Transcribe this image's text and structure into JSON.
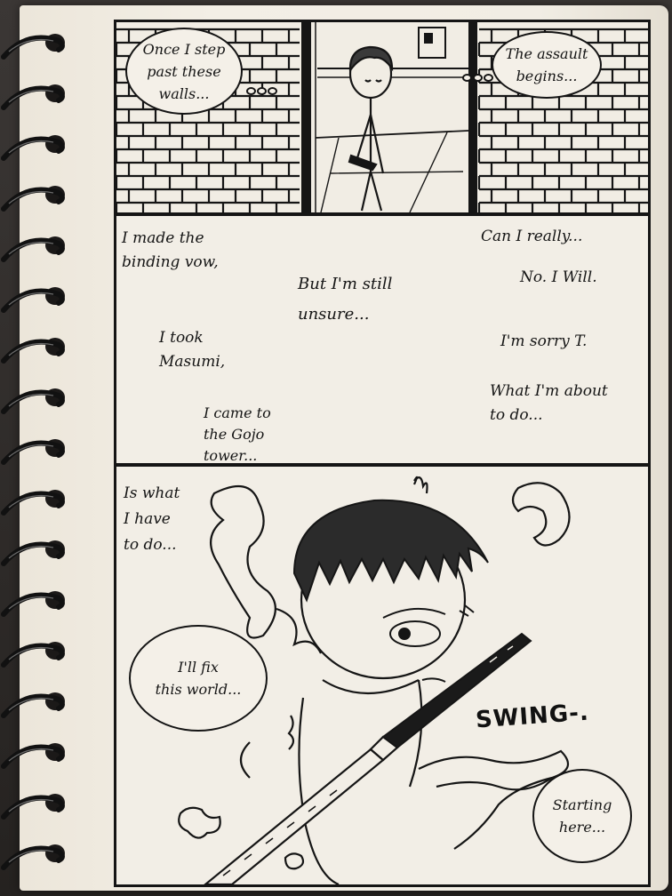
{
  "panels": {
    "top": {
      "bubble_left": "Once I step\npast these\nwalls...",
      "bubble_right": "The assault\nbegins..."
    },
    "middle": {
      "text_1": "I made the\nbinding vow,",
      "text_2": "But I'm still\nunsure...",
      "text_3": "I took\nMasumi,",
      "text_4": "I came to\nthe Gojo\ntower...",
      "text_5": "Can I really...",
      "text_6": "No. I Will.",
      "text_7": "I'm sorry T.",
      "text_8": "What I'm about\nto do..."
    },
    "bottom": {
      "caption": "Is what\nI have\nto do...",
      "bubble_left": "I'll fix\nthis world...",
      "sfx": "SWING-.",
      "bubble_right": "Starting\nhere..."
    }
  },
  "colors": {
    "paper": "#f2eee6",
    "ink": "#141414",
    "desk": "#2e2b2a",
    "spiral": "#111111"
  },
  "icons": {
    "binding": "spiral-binding-icon",
    "weapon": "sword-icon"
  }
}
